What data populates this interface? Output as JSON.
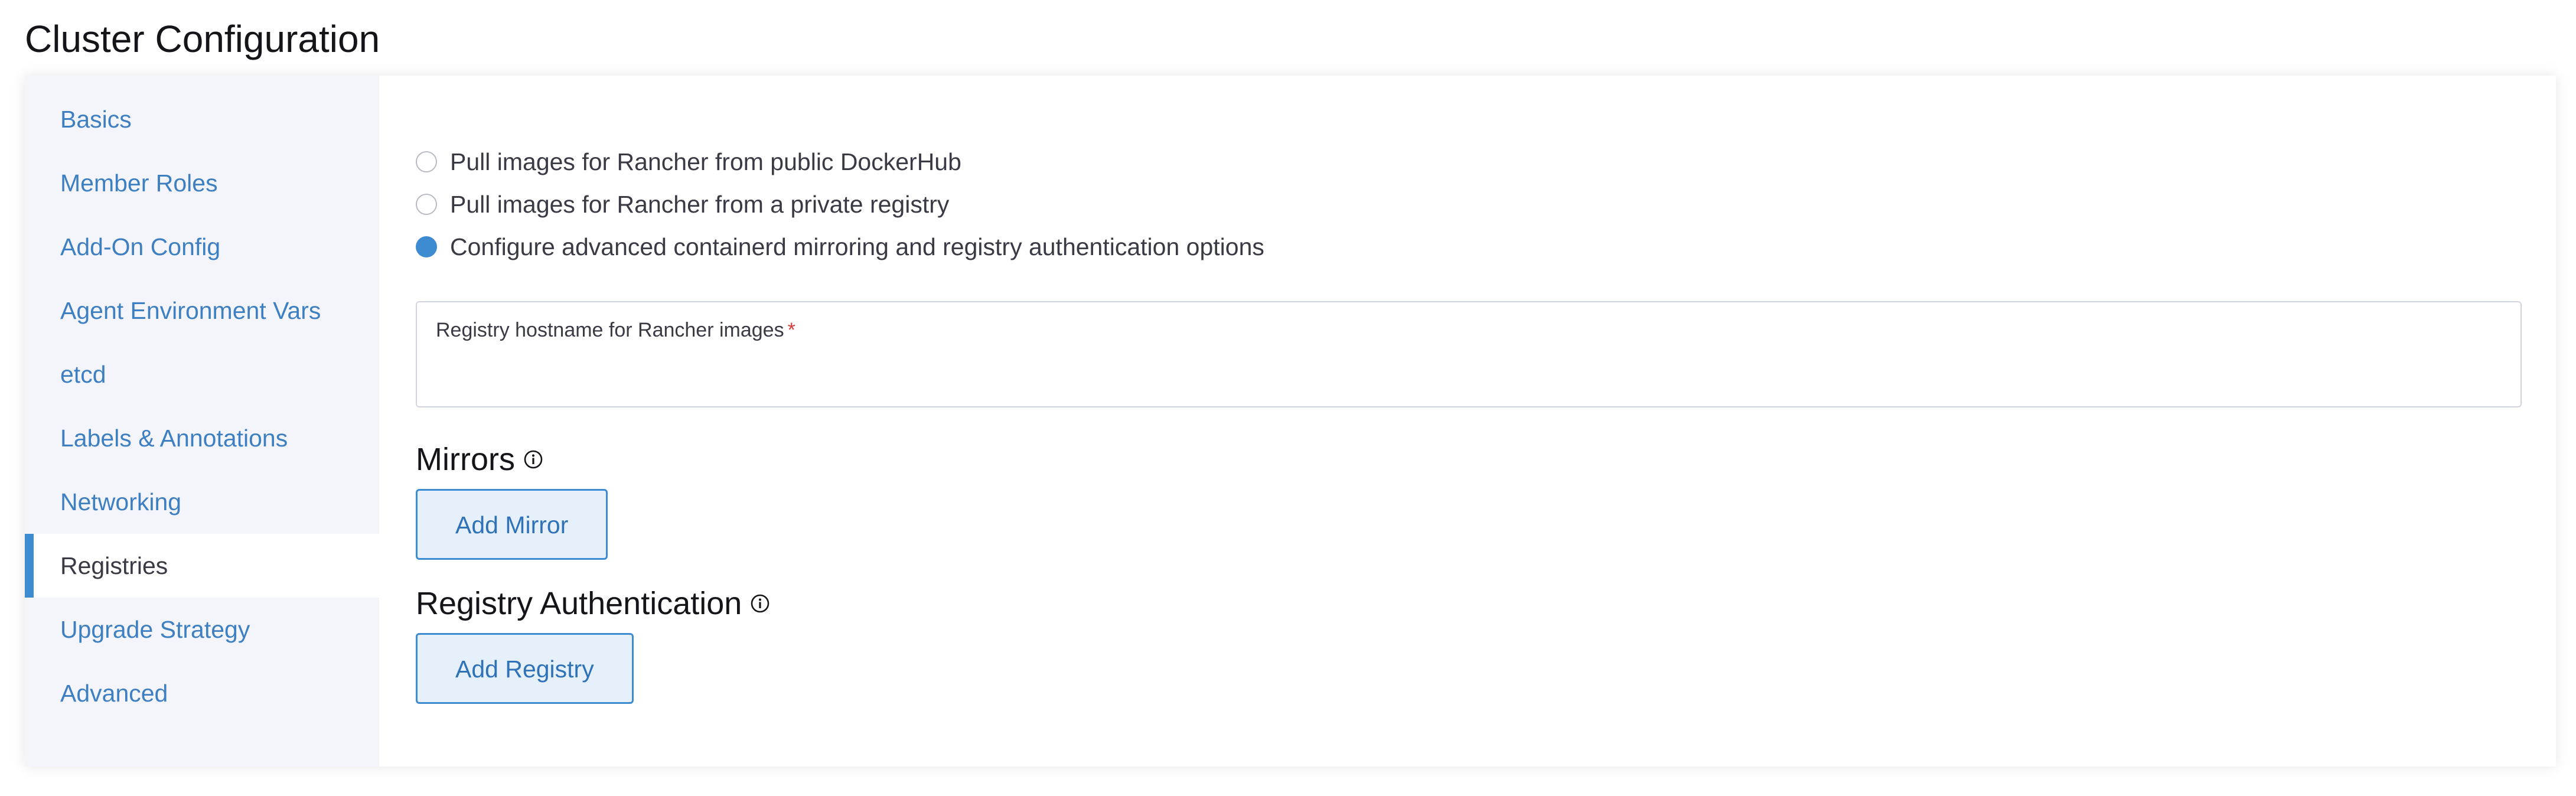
{
  "page": {
    "title": "Cluster Configuration"
  },
  "sidebar": {
    "items": [
      {
        "label": "Basics",
        "active": false
      },
      {
        "label": "Member Roles",
        "active": false
      },
      {
        "label": "Add-On Config",
        "active": false
      },
      {
        "label": "Agent Environment Vars",
        "active": false
      },
      {
        "label": "etcd",
        "active": false
      },
      {
        "label": "Labels & Annotations",
        "active": false
      },
      {
        "label": "Networking",
        "active": false
      },
      {
        "label": "Registries",
        "active": true
      },
      {
        "label": "Upgrade Strategy",
        "active": false
      },
      {
        "label": "Advanced",
        "active": false
      }
    ]
  },
  "registry_source": {
    "options": [
      {
        "label": "Pull images for Rancher from public DockerHub",
        "checked": false
      },
      {
        "label": "Pull images for Rancher from a private registry",
        "checked": false
      },
      {
        "label": "Configure advanced containerd mirroring and registry authentication options",
        "checked": true
      }
    ]
  },
  "hostname_field": {
    "label": "Registry hostname for Rancher images",
    "required_marker": "*",
    "value": ""
  },
  "mirrors": {
    "title": "Mirrors",
    "button_label": "Add Mirror"
  },
  "registry_auth": {
    "title": "Registry Authentication",
    "button_label": "Add Registry"
  },
  "colors": {
    "accent": "#3d8bd1",
    "link": "#3d7fc1",
    "sidebar_bg": "#f4f5fa",
    "required": "#d73a3a"
  },
  "icons": {
    "info": "info-circle-icon"
  }
}
